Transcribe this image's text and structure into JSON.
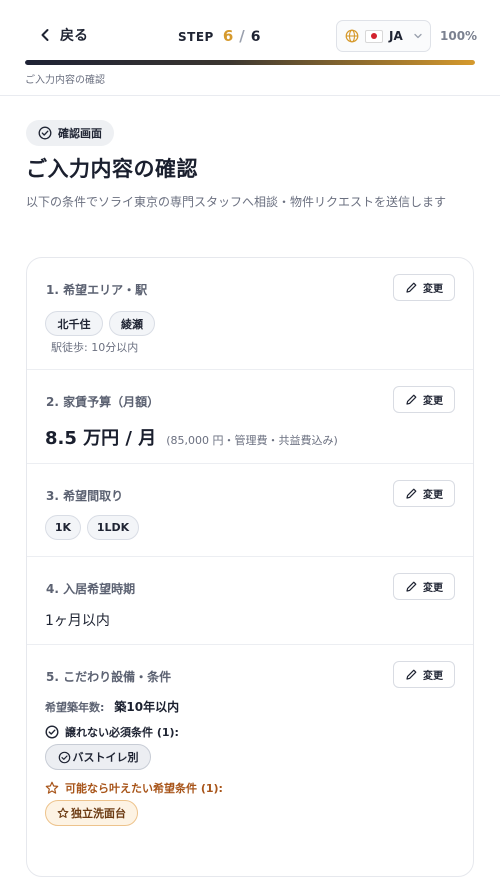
{
  "header": {
    "back_label": "戻る",
    "step_label": "STEP",
    "step_current": "6",
    "step_separator": "/",
    "step_total": "6",
    "language_code": "JA",
    "language_flag": "japan-flag-icon",
    "progress_percent_label": "100%",
    "progress_fraction": 1.0,
    "breadcrumb": "ご入力内容の確認"
  },
  "intro": {
    "badge": "確認画面",
    "title": "ご入力内容の確認",
    "description": "以下の条件でソライ東京の専門スタッフへ相談・物件リクエストを送信します"
  },
  "edit_label": "変更",
  "sections": {
    "area": {
      "title": "1. 希望エリア・駅",
      "stations": [
        "北千住",
        "綾瀬"
      ],
      "walk": "駅徒歩: 10分以内"
    },
    "budget": {
      "title": "2. 家賃予算（月額）",
      "amount": "8.5 万円 / 月",
      "note": "(85,000 円・管理費・共益費込み)"
    },
    "layout": {
      "title": "3. 希望間取り",
      "options": [
        "1K",
        "1LDK"
      ]
    },
    "move_in": {
      "title": "4. 入居希望時期",
      "value": "1ヶ月以内"
    },
    "facilities": {
      "title": "5. こだわり設備・条件",
      "age_label": "希望築年数:",
      "age_value": "築10年以内",
      "required_label": "譲れない必須条件 (1):",
      "required_items": [
        "バストイレ別"
      ],
      "wish_label": "可能なら叶えたい希望条件 (1):",
      "wish_items": [
        "独立洗面台"
      ]
    }
  },
  "colors": {
    "accent": "#d69a2d",
    "primary_text": "#1f2433",
    "muted_text": "#6b7080",
    "wish_text": "#a8551a"
  }
}
